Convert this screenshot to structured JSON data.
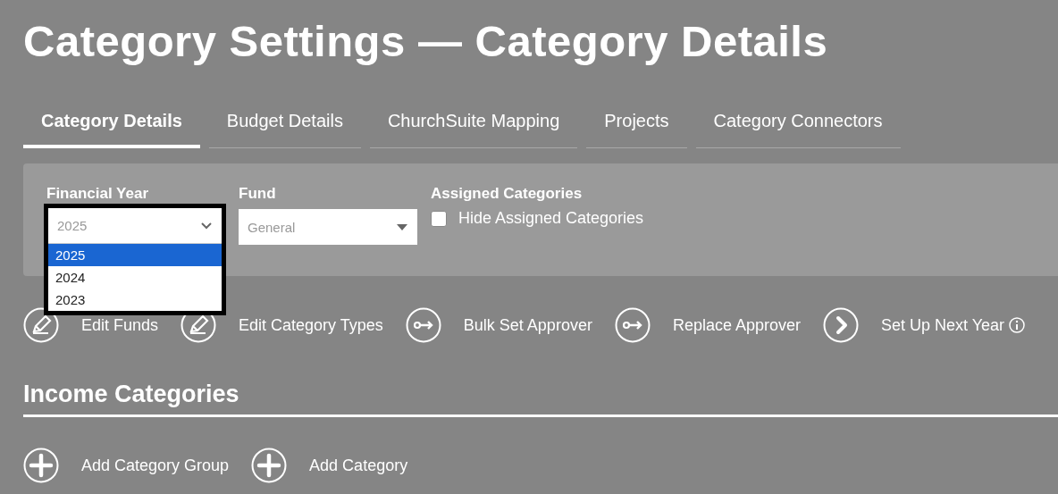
{
  "page_title": "Category Settings — Category Details",
  "tabs": [
    {
      "label": "Category Details",
      "selected": true
    },
    {
      "label": "Budget Details",
      "selected": false
    },
    {
      "label": "ChurchSuite Mapping",
      "selected": false
    },
    {
      "label": "Projects",
      "selected": false
    },
    {
      "label": "Category Connectors",
      "selected": false
    }
  ],
  "filters": {
    "financial_year": {
      "label": "Financial Year",
      "value": "2025",
      "expanded": true,
      "options": [
        {
          "label": "2025",
          "selected": true
        },
        {
          "label": "2024",
          "selected": false
        },
        {
          "label": "2023",
          "selected": false
        }
      ]
    },
    "fund": {
      "label": "Fund",
      "value": "General"
    },
    "assigned": {
      "label": "Assigned Categories",
      "checkbox_label": "Hide Assigned Categories",
      "checked": false
    }
  },
  "actions": [
    {
      "kind": "edit",
      "label": "Edit Funds"
    },
    {
      "kind": "edit",
      "label": "Edit Category Types"
    },
    {
      "kind": "key",
      "label": "Bulk Set Approver"
    },
    {
      "kind": "key",
      "label": "Replace Approver"
    },
    {
      "kind": "chevron",
      "label": "Set Up Next Year",
      "info": true
    }
  ],
  "section": {
    "title": "Income Categories",
    "actions": [
      {
        "kind": "plus",
        "label": "Add Category Group"
      },
      {
        "kind": "plus",
        "label": "Add Category"
      }
    ]
  }
}
